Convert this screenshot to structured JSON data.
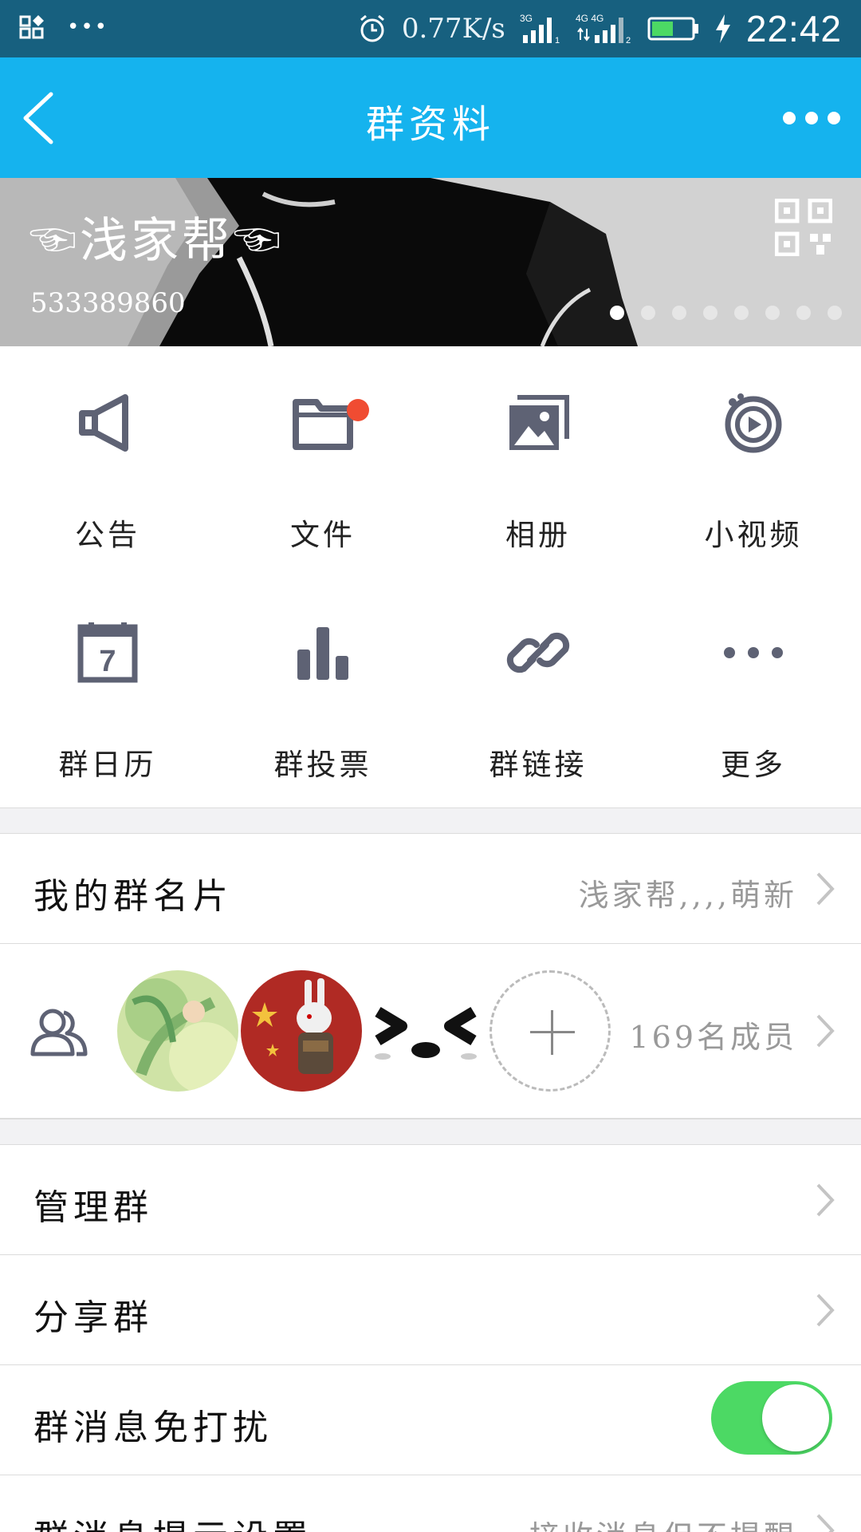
{
  "status_bar": {
    "speed": "0.77K/s",
    "net1": "3G",
    "net2": "4G 4G",
    "time": "22:42",
    "battery_level": 0.55
  },
  "titlebar": {
    "title": "群资料"
  },
  "banner": {
    "group_name": "☜浅家帮☜",
    "group_id": "533389860",
    "page_count": 8,
    "active_page": 1
  },
  "features": [
    {
      "label": "公告",
      "icon": "megaphone-icon"
    },
    {
      "label": "文件",
      "icon": "folder-icon",
      "badge": true
    },
    {
      "label": "相册",
      "icon": "album-icon"
    },
    {
      "label": "小视频",
      "icon": "video-play-icon"
    },
    {
      "label": "群日历",
      "icon": "calendar-icon",
      "calendar_day": "7"
    },
    {
      "label": "群投票",
      "icon": "bar-chart-icon"
    },
    {
      "label": "群链接",
      "icon": "link-icon"
    },
    {
      "label": "更多",
      "icon": "more-dots-icon"
    }
  ],
  "rows": {
    "card_label": "我的群名片",
    "card_value": "浅家帮,,,,萌新",
    "members_count": "169名成员",
    "manage_label": "管理群",
    "share_label": "分享群",
    "mute_label": "群消息免打扰",
    "mute_on": true,
    "notify_label": "群消息提示设置",
    "notify_value": "接收消息但不提醒"
  },
  "colors": {
    "statusbar": "#17607f",
    "accent": "#15b3ee",
    "icon_gray": "#5e6274",
    "badge_red": "#f04c32",
    "toggle_green": "#4cd964"
  }
}
